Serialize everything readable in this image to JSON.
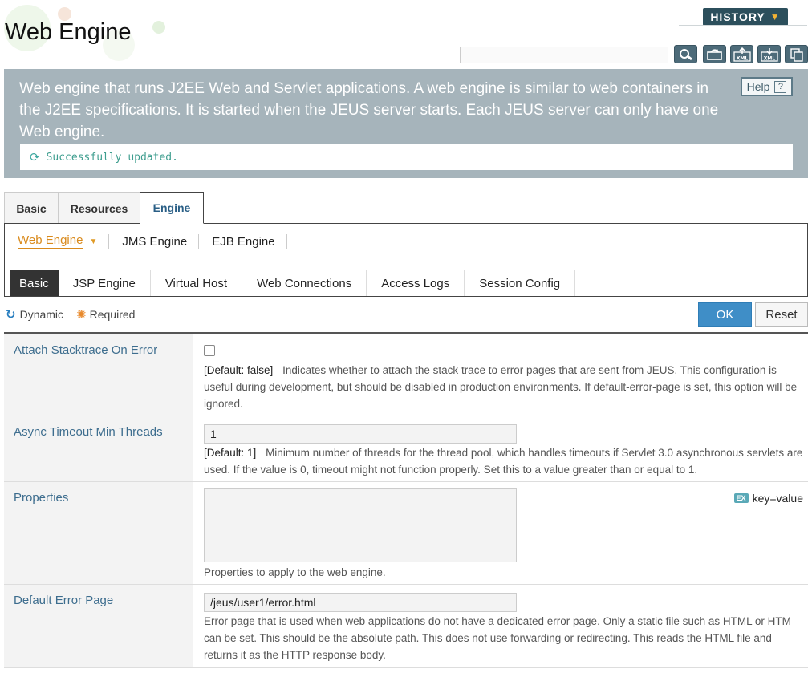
{
  "header": {
    "title": "Web Engine",
    "history_label": "HISTORY",
    "search_value": "",
    "toolbar_icons": [
      "search-icon",
      "refresh-icon",
      "export-xml-icon",
      "import-xml-icon",
      "copy-icon"
    ]
  },
  "description": {
    "text": "Web engine that runs J2EE Web and Servlet applications. A web engine is similar to web containers in the J2EE specifications. It is started when the JEUS server starts. Each JEUS server can only have one Web engine.",
    "help_label": "Help",
    "help_q": "?",
    "status_message": "Successfully updated."
  },
  "tabs": [
    {
      "label": "Basic"
    },
    {
      "label": "Resources"
    },
    {
      "label": "Engine"
    }
  ],
  "engine_tabs": [
    {
      "label": "Web Engine"
    },
    {
      "label": "JMS Engine"
    },
    {
      "label": "EJB Engine"
    }
  ],
  "web_tabs": [
    {
      "label": "Basic"
    },
    {
      "label": "JSP Engine"
    },
    {
      "label": "Virtual Host"
    },
    {
      "label": "Web Connections"
    },
    {
      "label": "Access Logs"
    },
    {
      "label": "Session Config"
    }
  ],
  "legend": {
    "dynamic": "Dynamic",
    "required": "Required"
  },
  "actions": {
    "ok": "OK",
    "reset": "Reset"
  },
  "fields": {
    "attach_stacktrace": {
      "label": "Attach Stacktrace On Error",
      "checked": false,
      "default": "[Default: false]",
      "desc": "Indicates whether to attach the stack trace to error pages that are sent from JEUS. This configuration is useful during development, but should be disabled in production environments. If default-error-page is set, this option will be ignored."
    },
    "async_timeout": {
      "label": "Async Timeout Min Threads",
      "value": "1",
      "default": "[Default: 1]",
      "desc": "Minimum number of threads for the thread pool, which handles timeouts if Servlet 3.0 asynchronous servlets are used. If the value is 0, timeout might not function properly. Set this to a value greater than or equal to 1."
    },
    "properties": {
      "label": "Properties",
      "value": "",
      "ex_badge": "EX",
      "ex_hint": "key=value",
      "desc": "Properties to apply to the web engine."
    },
    "default_error_page": {
      "label": "Default Error Page",
      "value": "/jeus/user1/error.html",
      "desc": "Error page that is used when web applications do not have a dedicated error page. Only a static file such as HTML or HTM can be set. This should be the absolute path. This does not use forwarding or redirecting. This reads the HTML file and returns it as the HTTP response body."
    }
  }
}
